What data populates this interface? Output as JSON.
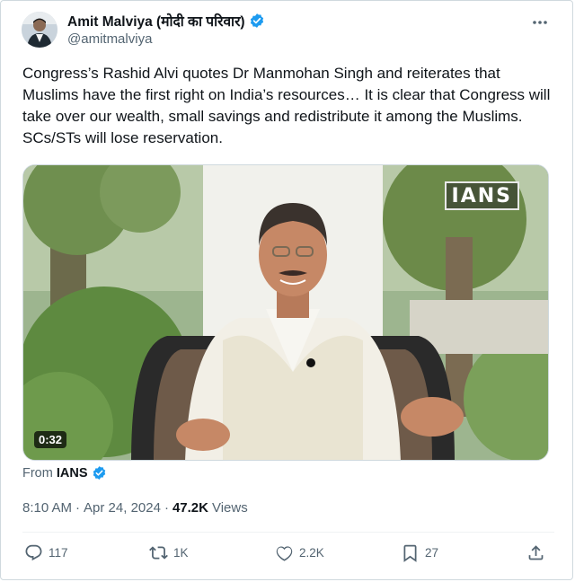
{
  "author": {
    "name": "Amit Malviya (मोदी का परिवार)",
    "handle": "@amitmalviya",
    "verified": true,
    "avatar_icon": "profile-photo"
  },
  "more_icon": "ellipsis-icon",
  "tweet": {
    "text": "Congress’s Rashid Alvi quotes Dr Manmohan Singh and reiterates that Muslims have the first right on India’s resources… It is clear that Congress will take over our wealth, small savings and redistribute it among the Muslims. SCs/STs will lose reservation."
  },
  "media": {
    "watermark": "IANS",
    "duration": "0:32"
  },
  "source": {
    "prefix": "From",
    "name": "IANS",
    "verified": true
  },
  "meta": {
    "time": "8:10 AM",
    "separator": "·",
    "date": "Apr 24, 2024",
    "separator2": "·",
    "views_count": "47.2K",
    "views_label": "Views"
  },
  "actions": {
    "reply": {
      "icon": "reply-icon",
      "count": "117"
    },
    "retweet": {
      "icon": "retweet-icon",
      "count": "1K"
    },
    "like": {
      "icon": "heart-icon",
      "count": "2.2K"
    },
    "bookmark": {
      "icon": "bookmark-icon",
      "count": "27"
    },
    "share": {
      "icon": "share-icon"
    }
  },
  "colors": {
    "text": "#0f1419",
    "secondary": "#536471",
    "verified_blue": "#1d9bf0",
    "border": "#cfd9de"
  }
}
